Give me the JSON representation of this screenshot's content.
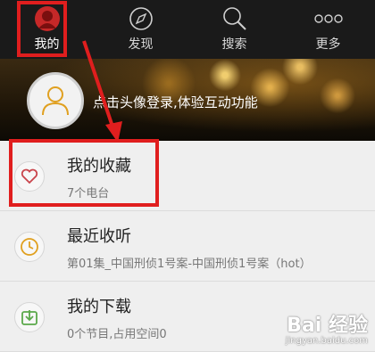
{
  "tabs": [
    {
      "label": "我的",
      "icon": "person-icon",
      "active": true
    },
    {
      "label": "发现",
      "icon": "compass-icon",
      "active": false
    },
    {
      "label": "搜索",
      "icon": "search-icon",
      "active": false
    },
    {
      "label": "更多",
      "icon": "more-dots-icon",
      "active": false
    }
  ],
  "banner": {
    "login_hint": "点击头像登录,体验互动功能",
    "avatar_icon": "user-avatar-icon"
  },
  "list": [
    {
      "title": "我的收藏",
      "subtitle": "7个电台",
      "icon": "heart-icon",
      "icon_color": "#c9444b"
    },
    {
      "title": "最近收听",
      "subtitle": "第01集_中国刑侦1号案-中国刑侦1号案（hot）",
      "icon": "clock-icon",
      "icon_color": "#e0a020"
    },
    {
      "title": "我的下载",
      "subtitle": "0个节目,占用空间0",
      "icon": "download-icon",
      "icon_color": "#5aa84a"
    }
  ],
  "watermark": {
    "main": "Bai 经验",
    "sub": "jingyan.baidu.com"
  },
  "colors": {
    "highlight": "#e01e1e",
    "topbar": "#1a1a1a",
    "list_bg": "#efefef"
  }
}
